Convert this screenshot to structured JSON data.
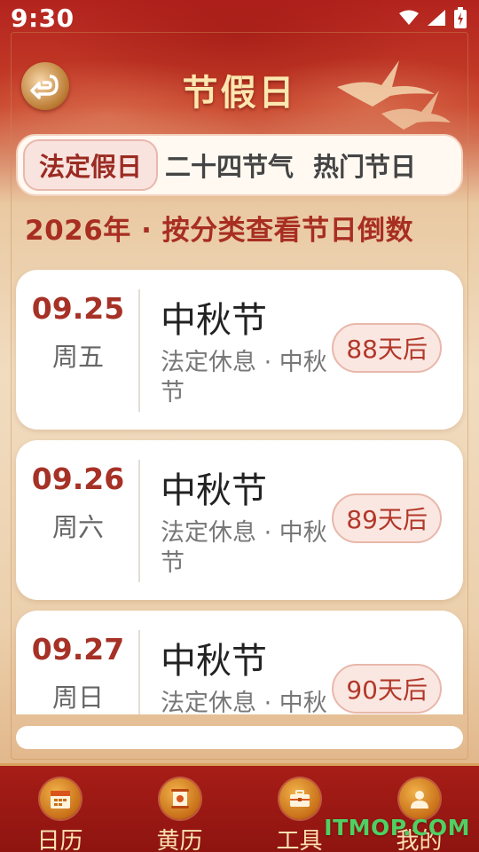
{
  "status_bar": {
    "time": "9:30"
  },
  "header": {
    "title": "节假日"
  },
  "tabs": [
    {
      "label": "法定假日",
      "active": true
    },
    {
      "label": "二十四节气",
      "active": false
    },
    {
      "label": "热门节日",
      "active": false
    }
  ],
  "subtitle": "2026年 · 按分类查看节日倒数",
  "holidays": [
    {
      "date": "09.25",
      "weekday": "周五",
      "name": "中秋节",
      "desc": "法定休息 · 中秋节",
      "countdown": "88天后"
    },
    {
      "date": "09.26",
      "weekday": "周六",
      "name": "中秋节",
      "desc": "法定休息 · 中秋节",
      "countdown": "89天后"
    },
    {
      "date": "09.27",
      "weekday": "周日",
      "name": "中秋节",
      "desc": "法定休息 · 中秋",
      "countdown": "90天后"
    }
  ],
  "bottom_nav": [
    {
      "label": "日历",
      "icon": "calendar-icon"
    },
    {
      "label": "黄历",
      "icon": "scroll-icon"
    },
    {
      "label": "工具",
      "icon": "toolbox-icon"
    },
    {
      "label": "我的",
      "icon": "user-icon"
    }
  ],
  "watermark": "ITMOP.COM",
  "colors": {
    "accent": "#a63126",
    "nav_bg": "#a71d17",
    "title": "#fde7b0"
  }
}
